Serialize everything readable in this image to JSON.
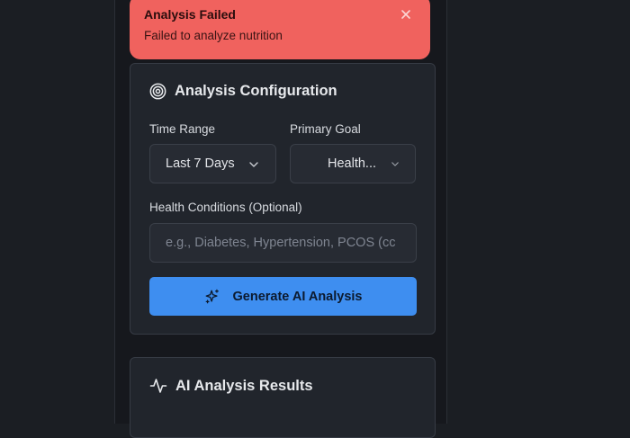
{
  "toast": {
    "title": "Analysis Failed",
    "message": "Failed to analyze nutrition",
    "close_icon": "close-icon",
    "color": "#f0625e"
  },
  "config": {
    "title": "Analysis Configuration",
    "icon": "target-icon",
    "time_range": {
      "label": "Time Range",
      "value": "Last 7 Days"
    },
    "primary_goal": {
      "label": "Primary Goal",
      "value": "Health..."
    },
    "health_conditions": {
      "label": "Health Conditions (Optional)",
      "placeholder": "e.g., Diabetes, Hypertension, PCOS (cc"
    },
    "generate_button": {
      "label": "Generate AI Analysis",
      "icon": "sparkles-icon",
      "color": "#3e8ef0"
    }
  },
  "results": {
    "title": "AI Analysis Results",
    "icon": "activity-icon"
  }
}
